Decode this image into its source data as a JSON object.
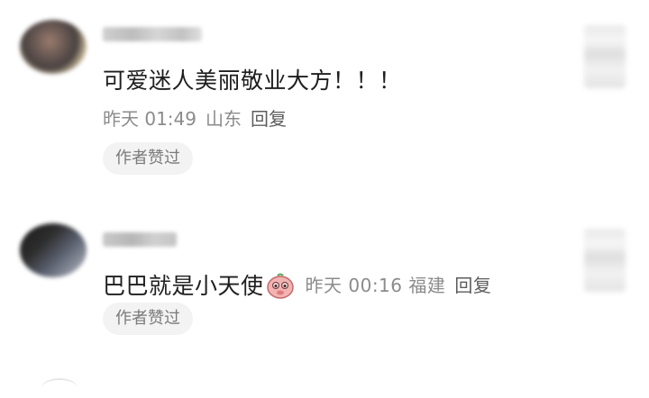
{
  "comments": [
    {
      "text": "可爱迷人美丽敬业大方！！！",
      "time": "昨天 01:49",
      "location": "山东",
      "reply_label": "回复",
      "badge": "作者赞过"
    },
    {
      "text": "巴巴就是小天使",
      "emoji": "pink-face-emoji",
      "time": "昨天 00:16",
      "location": "福建",
      "reply_label": "回复",
      "badge": "作者赞过"
    }
  ],
  "icons": {
    "emoji": "pink-face-emoji"
  },
  "colors": {
    "text_primary": "#1e1e1e",
    "text_meta": "#8b8b8b",
    "badge_bg": "#f3f3f3",
    "emoji_pink": "#f2b3b3"
  }
}
